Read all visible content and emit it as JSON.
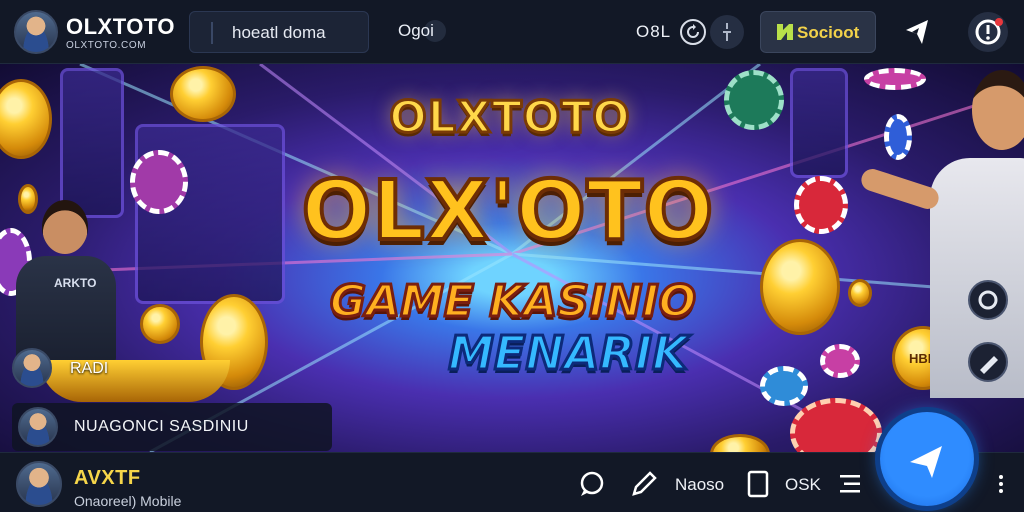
{
  "header": {
    "brand_title": "OLXTOTO",
    "brand_subtitle": "OLXTOTO.COM",
    "search_value": "hoeatl doma",
    "mid_label": "Ogoi",
    "code_label": "O8L",
    "social_button_label": "Socioot",
    "icons": [
      "avatar",
      "refresh-icon",
      "info-icon",
      "star-icon",
      "share-icon",
      "alert-icon"
    ]
  },
  "hero": {
    "logo_top": "OLXTOTO",
    "logo_main": "OLX'OTO",
    "logo_game": "GAME KASINIO",
    "logo_sub": "MENARIK",
    "dealer_badge": "ARKTO",
    "chip_label": "HBRO",
    "small_tag_label": "RADI",
    "tag_card_label": "NUAGONCI SASDINIU"
  },
  "bottom": {
    "user_name": "AVXTF",
    "user_status": "Onaoreel) Mobile",
    "nav_label_1": "Naoso",
    "nav_label_2": "OSK",
    "icons": [
      "chat-icon",
      "pen-icon",
      "tablet-icon",
      "menu-icon",
      "send-icon",
      "more-icon"
    ]
  },
  "colors": {
    "accent_gold": "#ffc21e",
    "accent_blue": "#2f8cff",
    "bar_bg": "#121826",
    "social_text": "#f2d24a"
  }
}
